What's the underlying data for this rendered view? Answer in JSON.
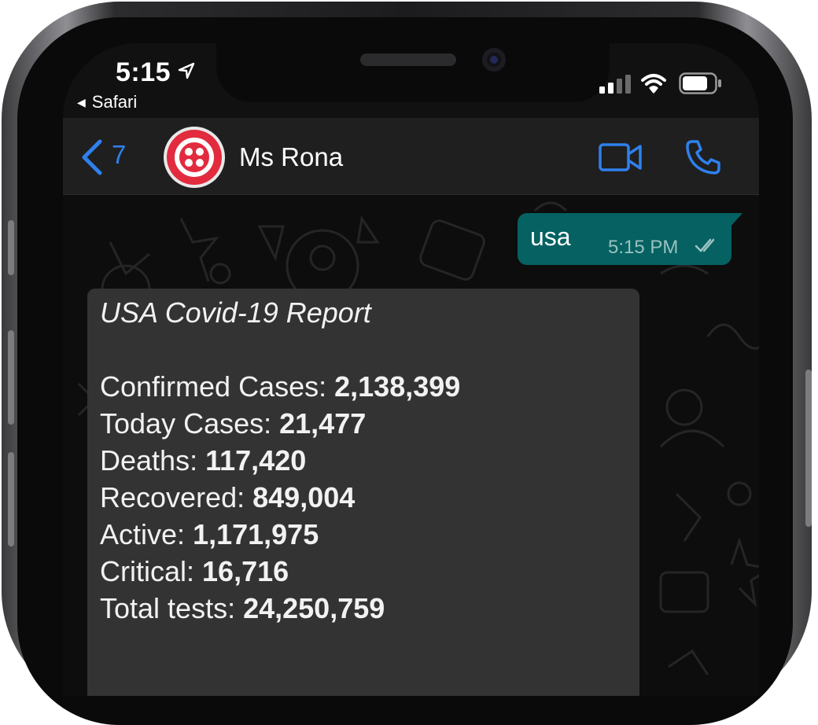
{
  "status_bar": {
    "time": "5:15",
    "back_app": "Safari"
  },
  "header": {
    "back_count": "7",
    "contact_name": "Ms Rona"
  },
  "messages": {
    "outgoing": {
      "text": "usa",
      "time": "5:15 PM"
    },
    "incoming": {
      "title": "USA Covid-19 Report",
      "stats": [
        {
          "label": "Confirmed Cases:",
          "value": "2,138,399"
        },
        {
          "label": "Today Cases:",
          "value": "21,477"
        },
        {
          "label": "Deaths:",
          "value": "117,420"
        },
        {
          "label": "Recovered:",
          "value": "849,004"
        },
        {
          "label": "Active:",
          "value": "1,171,975"
        },
        {
          "label": "Critical:",
          "value": "16,716"
        },
        {
          "label": "Total tests:",
          "value": "24,250,759"
        }
      ]
    }
  },
  "icons": [
    "location-arrow-icon",
    "signal-icon",
    "wifi-icon",
    "battery-icon",
    "chevron-left-icon",
    "video-call-icon",
    "phone-icon",
    "read-receipt-icon"
  ],
  "colors": {
    "accent": "#2f80ed",
    "outgoing_bubble": "#056162",
    "incoming_bubble": "#333333",
    "avatar": "#e22b3e"
  }
}
